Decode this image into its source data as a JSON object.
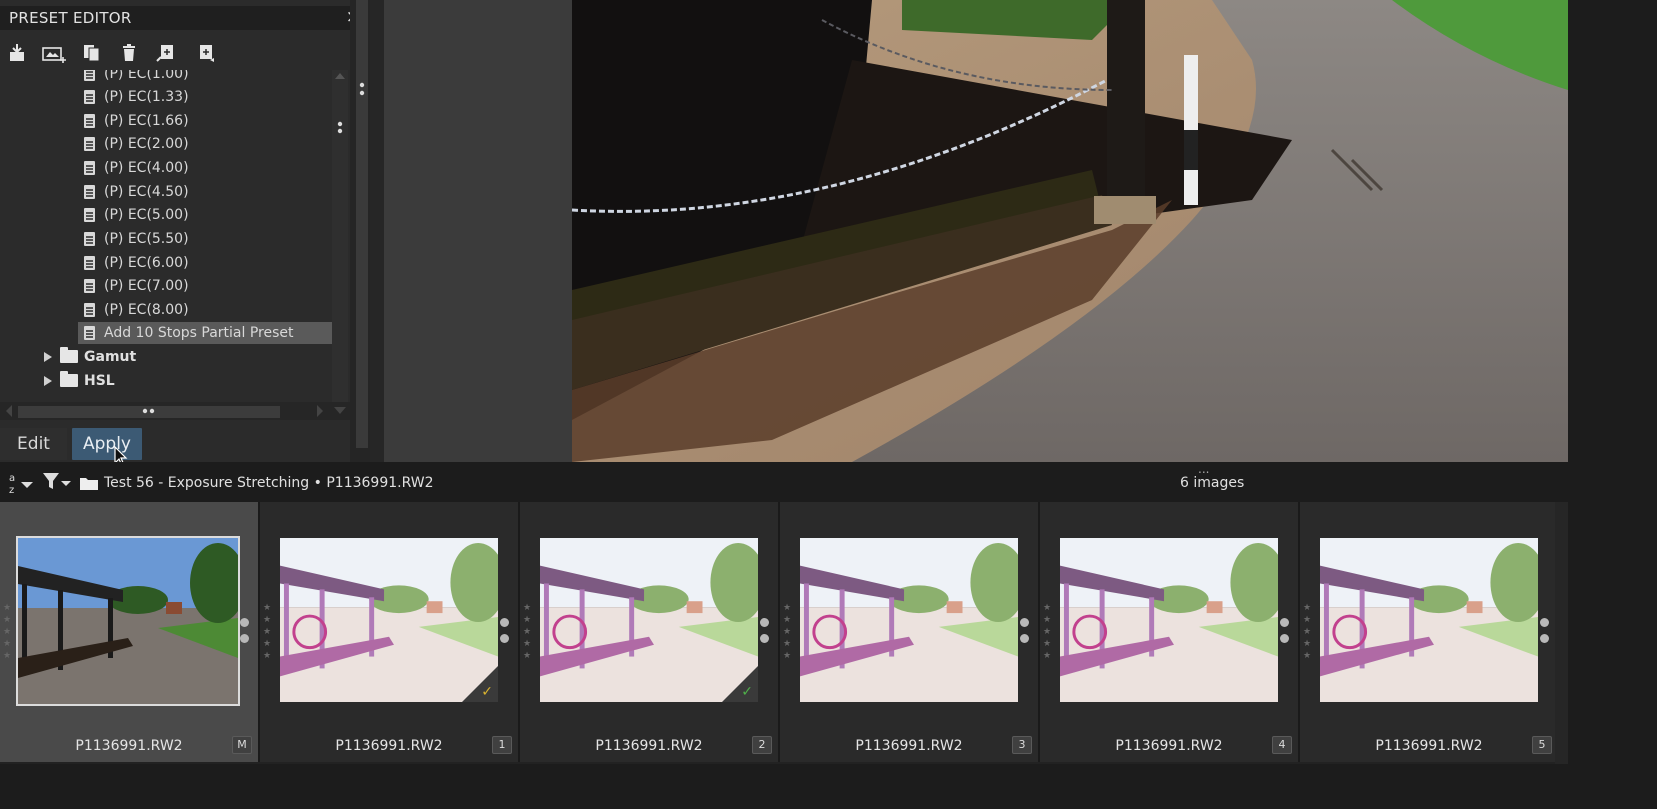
{
  "panel": {
    "title": "PRESET EDITOR",
    "close_glyph": "×",
    "toolbar_icons": [
      "import-preset-icon",
      "new-preset-from-image-icon",
      "duplicate-preset-icon",
      "delete-preset-icon",
      "apply-partial-icon",
      "export-preset-icon"
    ]
  },
  "tree": {
    "items": [
      "(P) EC(1.00)",
      "(P) EC(1.33)",
      "(P) EC(1.66)",
      "(P) EC(2.00)",
      "(P) EC(4.00)",
      "(P) EC(4.50)",
      "(P) EC(5.00)",
      "(P) EC(5.50)",
      "(P) EC(6.00)",
      "(P) EC(7.00)",
      "(P) EC(8.00)"
    ],
    "selected_item": "Add 10 Stops Partial Preset",
    "folders": [
      "Gamut",
      "HSL"
    ]
  },
  "buttons": {
    "edit": "Edit",
    "apply": "Apply"
  },
  "filmstrip_header": {
    "folder_path": "Test 56 - Exposure Stretching  •  P1136991.RW2",
    "image_count": "6 images",
    "dots": "..."
  },
  "filmstrip": {
    "cells": [
      {
        "name": "P1136991.RW2",
        "badge": "M",
        "check_color": ""
      },
      {
        "name": "P1136991.RW2",
        "badge": "1",
        "check_color": "#d8b230"
      },
      {
        "name": "P1136991.RW2",
        "badge": "2",
        "check_color": "#4fb04a"
      },
      {
        "name": "P1136991.RW2",
        "badge": "3",
        "check_color": ""
      },
      {
        "name": "P1136991.RW2",
        "badge": "4",
        "check_color": ""
      },
      {
        "name": "P1136991.RW2",
        "badge": "5",
        "check_color": ""
      }
    ]
  },
  "colors": {
    "apply_button": "#3c5a74",
    "selected_row": "#5a5a5a"
  }
}
